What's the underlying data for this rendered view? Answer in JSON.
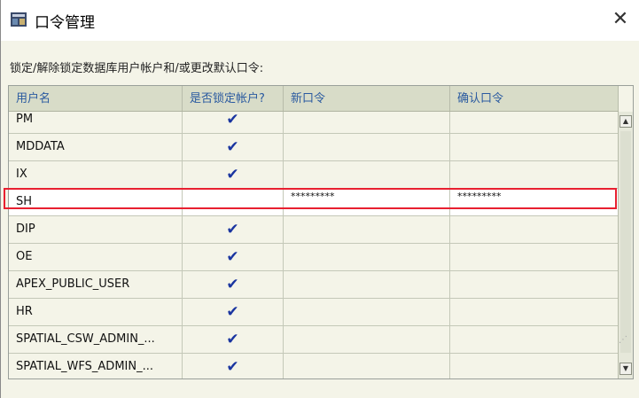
{
  "window": {
    "title": "口令管理",
    "close_glyph": "✕"
  },
  "instruction": "锁定/解除锁定数据库用户帐户和/或更改默认口令:",
  "columns": [
    "用户名",
    "是否锁定帐户?",
    "新口令",
    "确认口令"
  ],
  "check_glyph": "✔",
  "rows": [
    {
      "user": "PM",
      "locked": true,
      "new_password": "",
      "confirm_password": ""
    },
    {
      "user": "MDDATA",
      "locked": true,
      "new_password": "",
      "confirm_password": ""
    },
    {
      "user": "IX",
      "locked": true,
      "new_password": "",
      "confirm_password": ""
    },
    {
      "user": "SH",
      "locked": false,
      "new_password": "*********",
      "confirm_password": "*********"
    },
    {
      "user": "DIP",
      "locked": true,
      "new_password": "",
      "confirm_password": ""
    },
    {
      "user": "OE",
      "locked": true,
      "new_password": "",
      "confirm_password": ""
    },
    {
      "user": "APEX_PUBLIC_USER",
      "locked": true,
      "new_password": "",
      "confirm_password": ""
    },
    {
      "user": "HR",
      "locked": true,
      "new_password": "",
      "confirm_password": ""
    },
    {
      "user": "SPATIAL_CSW_ADMIN_...",
      "locked": true,
      "new_password": "",
      "confirm_password": ""
    },
    {
      "user": "SPATIAL_WFS_ADMIN_...",
      "locked": true,
      "new_password": "",
      "confirm_password": ""
    }
  ],
  "colors": {
    "header_text": "#2a5aa0",
    "checkmark": "#1a35a0",
    "highlight": "#e82030"
  }
}
